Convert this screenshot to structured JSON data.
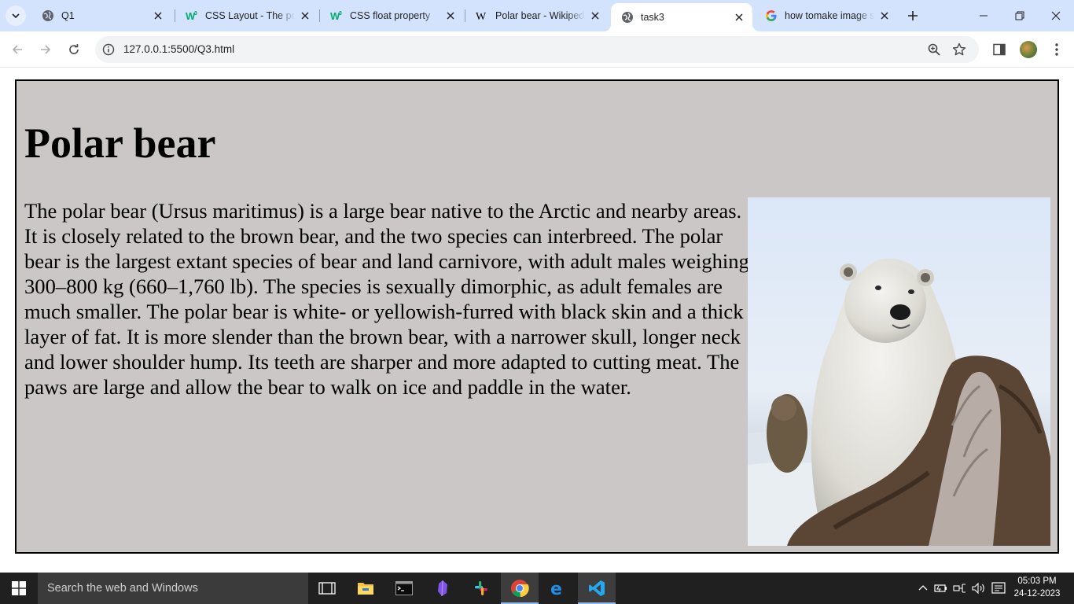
{
  "browser": {
    "tabs": [
      {
        "title": "Q1",
        "favicon": "globe-icon",
        "active": false
      },
      {
        "title": "CSS Layout - The position Property",
        "favicon": "w3schools-icon",
        "active": false
      },
      {
        "title": "CSS float property",
        "favicon": "w3schools-icon",
        "active": false
      },
      {
        "title": "Polar bear - Wikipedia",
        "favicon": "wikipedia-icon",
        "active": false
      },
      {
        "title": "task3",
        "favicon": "globe-icon",
        "active": true
      },
      {
        "title": "how tomake image stick to the right",
        "favicon": "google-icon",
        "active": false
      }
    ],
    "url": "127.0.0.1:5500/Q3.html"
  },
  "page": {
    "heading": "Polar bear",
    "paragraph": "The polar bear (Ursus maritimus) is a large bear native to the Arctic and nearby areas. It is closely related to the brown bear, and the two species can interbreed. The polar bear is the largest extant species of bear and land carnivore, with adult males weighing 300–800 kg (660–1,760 lb). The species is sexually dimorphic, as adult females are much smaller. The polar bear is white- or yellowish-furred with black skin and a thick layer of fat. It is more slender than the brown bear, with a narrower skull, longer neck and lower shoulder hump. Its teeth are sharper and more adapted to cutting meat. The paws are large and allow the bear to walk on ice and paddle in the water."
  },
  "taskbar": {
    "search_placeholder": "Search the web and Windows",
    "time": "05:03 PM",
    "date": "24-12-2023"
  },
  "colors": {
    "tabstrip": "#d3e3fd",
    "page_box": "#cbc7c6",
    "taskbar": "#202020"
  }
}
